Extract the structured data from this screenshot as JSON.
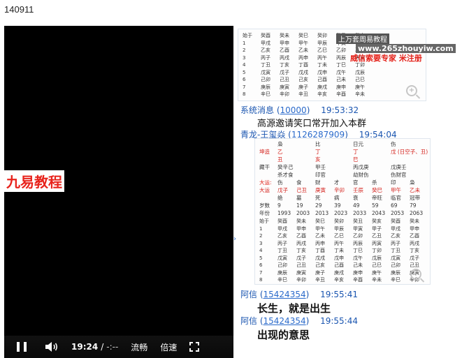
{
  "window": {
    "title": "140911"
  },
  "video": {
    "watermark": "九易教程",
    "controls": {
      "current_time": "19:24",
      "separator": "/",
      "duration": "-:--",
      "quality_label": "流畅",
      "speed_label": "倍速"
    }
  },
  "chat": {
    "chart1": {
      "banner": "上万套周易教程",
      "url": "www.265zhouyiw.com",
      "red_text": "威信索要专家  米注册",
      "rows": [
        [
          "始于",
          "癸酉",
          "癸未",
          "癸巳",
          "癸卯",
          "癸丑",
          "癸亥"
        ],
        [
          "1",
          "甲戌",
          "甲申",
          "甲午",
          "甲辰",
          "甲寅",
          "甲子"
        ],
        [
          "2",
          "乙亥",
          "乙酉",
          "乙未",
          "乙巳",
          "乙卯",
          "乙丑"
        ],
        [
          "3",
          "丙子",
          "丙戌",
          "丙申",
          "丙午",
          "丙辰",
          "丙寅"
        ],
        [
          "4",
          "丁丑",
          "丁亥",
          "丁酉",
          "丁未",
          "丁巳",
          "丁卯"
        ],
        [
          "5",
          "戊寅",
          "戊子",
          "戊戌",
          "戊申",
          "戊午",
          "戊辰"
        ],
        [
          "6",
          "己卯",
          "己丑",
          "己亥",
          "己酉",
          "己未",
          "己巳"
        ],
        [
          "7",
          "庚辰",
          "庚寅",
          "庚子",
          "庚戌",
          "庚申",
          "庚午"
        ],
        [
          "8",
          "辛巳",
          "辛卯",
          "辛丑",
          "辛亥",
          "辛酉",
          "辛未"
        ]
      ]
    },
    "msg_system": {
      "sender": "系统消息",
      "id": "10000",
      "time": "19:53:32",
      "text": "高源邀请笑口常开加入本群"
    },
    "msg_qinglong": {
      "sender": "青龙-王玺焱",
      "id": "1126287909",
      "time": "19:54:04"
    },
    "chart2": {
      "header": [
        "",
        "枭",
        "比",
        "日元",
        "伤"
      ],
      "pillars_label": "坤造",
      "stems": [
        "乙",
        "丁",
        "丁",
        "戊 (日空子、丑)"
      ],
      "branches": [
        "丑",
        "亥",
        "巳",
        ""
      ],
      "hidden_label": "藏干",
      "hidden": [
        "癸辛己",
        "甲壬",
        "丙戊庚",
        "戊庚壬"
      ],
      "hidden_gods": [
        "杀才食",
        "印官",
        "劫财伤",
        "伤财官"
      ],
      "dayun_label": "大运:",
      "dayun_gods": [
        "伤",
        "食",
        "财",
        "才",
        "官",
        "杀",
        "印",
        "枭"
      ],
      "dayun_label2": "大运",
      "dayun": [
        "戊子",
        "己丑",
        "庚寅",
        "辛卯",
        "壬辰",
        "癸巳",
        "甲午",
        "乙未"
      ],
      "dayun_stage": [
        "绝",
        "墓",
        "死",
        "病",
        "衰",
        "帝旺",
        "临官",
        "冠带"
      ],
      "age_label": "岁数",
      "ages": [
        "9",
        "19",
        "29",
        "39",
        "49",
        "59",
        "69",
        "79"
      ],
      "year_label": "年份",
      "years": [
        "1993",
        "2003",
        "2013",
        "2023",
        "2033",
        "2043",
        "2053",
        "2063"
      ],
      "rows": [
        [
          "始于",
          "癸酉",
          "癸未",
          "癸巳",
          "癸卯",
          "癸丑",
          "癸亥",
          "癸酉",
          "癸未"
        ],
        [
          "1",
          "甲戌",
          "甲申",
          "甲午",
          "甲辰",
          "甲寅",
          "甲子",
          "甲戌",
          "甲申"
        ],
        [
          "2",
          "乙亥",
          "乙酉",
          "乙未",
          "乙巳",
          "乙卯",
          "乙丑",
          "乙亥",
          "乙酉"
        ],
        [
          "3",
          "丙子",
          "丙戌",
          "丙申",
          "丙午",
          "丙辰",
          "丙寅",
          "丙子",
          "丙戌"
        ],
        [
          "4",
          "丁丑",
          "丁亥",
          "丁酉",
          "丁未",
          "丁巳",
          "丁卯",
          "丁丑",
          "丁亥"
        ],
        [
          "5",
          "戊寅",
          "戊子",
          "戊戌",
          "戊申",
          "戊午",
          "戊辰",
          "戊寅",
          "戊子"
        ],
        [
          "6",
          "己卯",
          "己丑",
          "己亥",
          "己酉",
          "己未",
          "己巳",
          "己卯",
          "己丑"
        ],
        [
          "7",
          "庚辰",
          "庚寅",
          "庚子",
          "庚戌",
          "庚申",
          "庚午",
          "庚辰",
          "庚寅"
        ],
        [
          "8",
          "辛巳",
          "辛卯",
          "辛丑",
          "辛亥",
          "辛酉",
          "辛未",
          "辛巳",
          "辛卯"
        ]
      ]
    },
    "msg_axin1": {
      "sender": "阿信",
      "id": "15424354",
      "time": "19:55:41",
      "text": "长生，就是出生"
    },
    "msg_axin2": {
      "sender": "阿信",
      "id": "15424354",
      "time": "19:55:44",
      "text": "出现的意思"
    }
  }
}
